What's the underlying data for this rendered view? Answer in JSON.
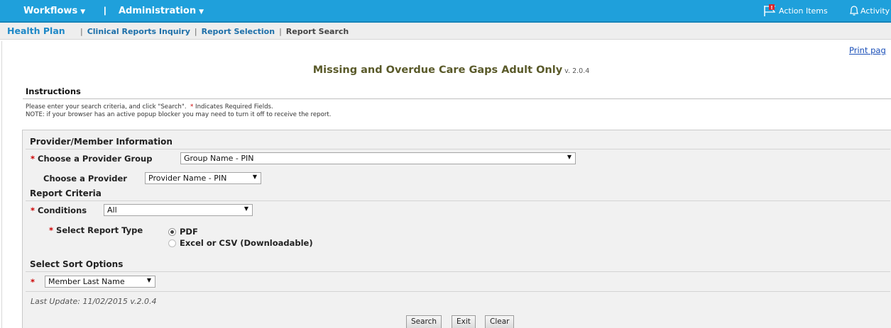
{
  "topnav": {
    "workflows": "Workflows",
    "administration": "Administration",
    "separator": "|",
    "action_items": "Action Items",
    "activity": "Activity"
  },
  "breadcrumb": {
    "home": "Health Plan",
    "items": [
      "Clinical Reports Inquiry",
      "Report Selection",
      "Report Search"
    ]
  },
  "print_link": "Print pag",
  "report": {
    "title": "Missing and Overdue Care Gaps Adult Only",
    "version": "v. 2.0.4"
  },
  "instructions": {
    "heading": "Instructions",
    "line1_prefix": "Please enter your search criteria, and click \"Search\".  ",
    "line1_star": "*",
    "line1_suffix": " Indicates Required Fields.",
    "line2": "NOTE: if your browser has an active popup blocker you may need to turn it off to receive the report."
  },
  "form": {
    "provider_section": "Provider/Member Information",
    "provider_group_label": "Choose a Provider Group",
    "provider_group_value": "Group Name - PIN",
    "provider_label": "Choose a Provider",
    "provider_value": "Provider Name - PIN",
    "criteria_section": "Report Criteria",
    "conditions_label": "Conditions",
    "conditions_value": "All",
    "report_type_label": "Select Report Type",
    "report_type_options": [
      "PDF",
      "Excel or CSV (Downloadable)"
    ],
    "report_type_selected": "PDF",
    "sort_section": "Select Sort Options",
    "sort_value": "Member Last Name",
    "required_star": "*",
    "last_update": "Last Update: 11/02/2015 v.2.0.4"
  },
  "buttons": {
    "search": "Search",
    "exit": "Exit",
    "clear": "Clear"
  },
  "colors": {
    "topnav_bg": "#1fa0db",
    "title_color": "#5a5a2a",
    "required": "#cc0000",
    "link": "#1d6fa9",
    "badge": "#d9262c"
  },
  "icons": {
    "action_items": "flag-with-badge-icon",
    "activity": "bell-icon",
    "dropdown": "chevron-down-icon"
  }
}
